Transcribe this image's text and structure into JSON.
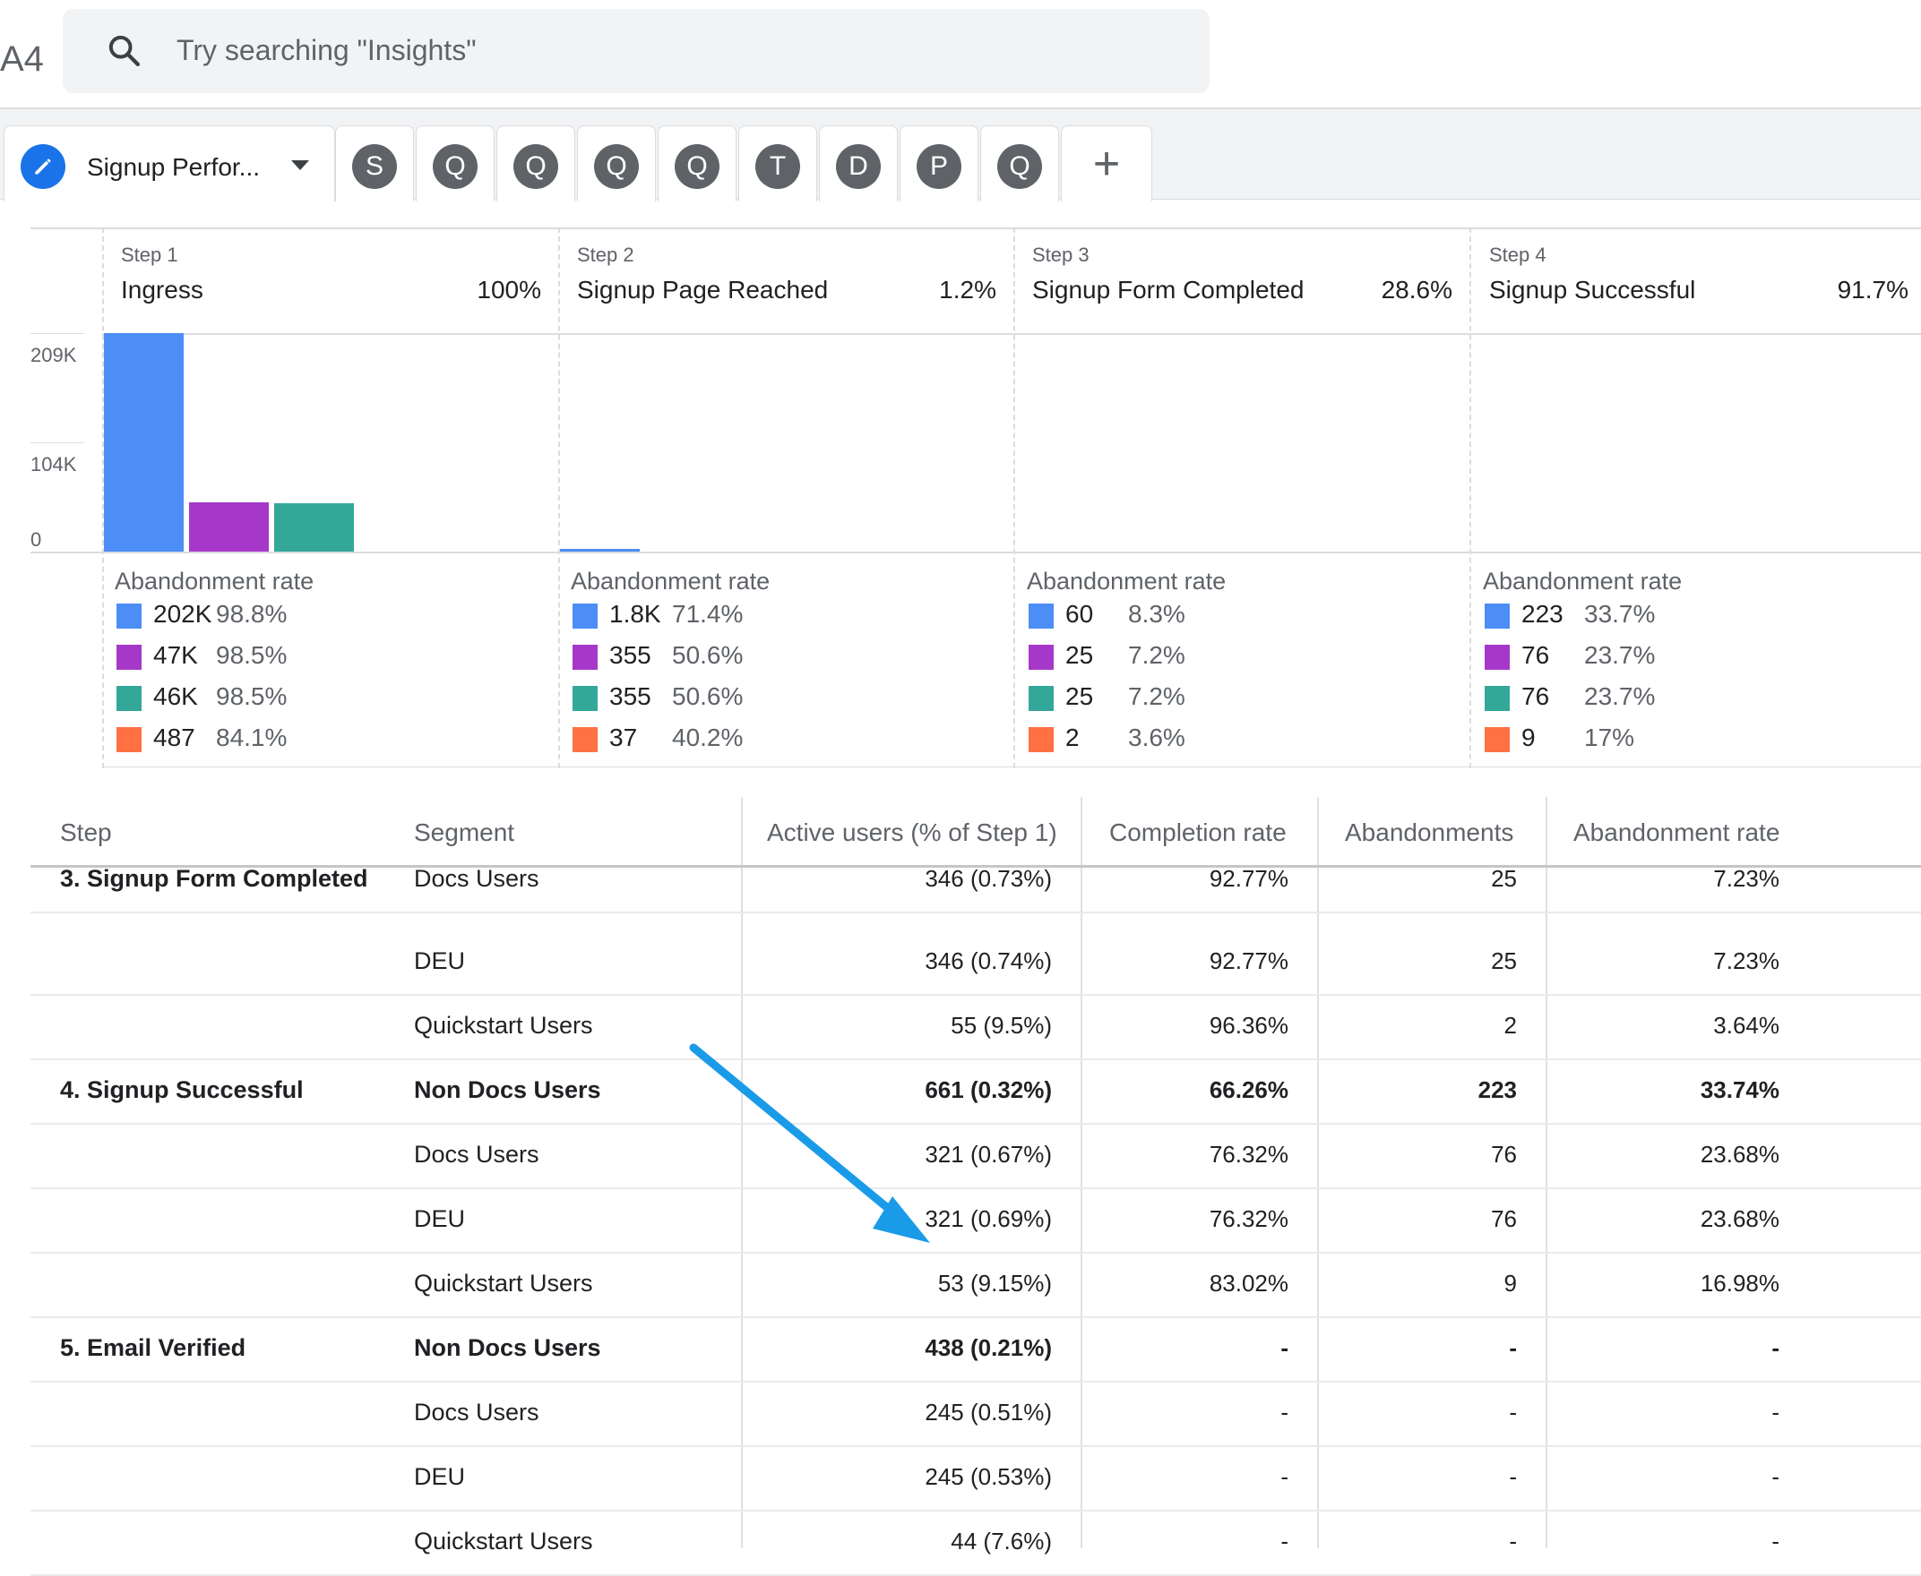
{
  "brand": "A4",
  "search": {
    "placeholder": "Try searching \"Insights\"",
    "icon": "search-icon"
  },
  "tabs": {
    "active": {
      "label": "Signup Perfor...",
      "icon": "pencil-icon"
    },
    "others": [
      "S",
      "Q",
      "Q",
      "Q",
      "Q",
      "T",
      "D",
      "P",
      "Q"
    ],
    "add_label": "+"
  },
  "colors": {
    "blue": "#4c8df6",
    "purple": "#a638c9",
    "teal": "#33a89a",
    "orange": "#ff7043",
    "arrow": "#1a9be8"
  },
  "funnel": {
    "steps": [
      {
        "step": "Step 1",
        "name": "Ingress",
        "pct": "100%"
      },
      {
        "step": "Step 2",
        "name": "Signup Page Reached",
        "pct": "1.2%"
      },
      {
        "step": "Step 3",
        "name": "Signup Form Completed",
        "pct": "28.6%"
      },
      {
        "step": "Step 4",
        "name": "Signup Successful",
        "pct": "91.7%"
      }
    ],
    "axis": [
      "209K",
      "104K",
      "0"
    ],
    "abandonment_title": "Abandonment rate",
    "abandonment": [
      [
        {
          "v": "202K",
          "p": "98.8%"
        },
        {
          "v": "47K",
          "p": "98.5%"
        },
        {
          "v": "46K",
          "p": "98.5%"
        },
        {
          "v": "487",
          "p": "84.1%"
        }
      ],
      [
        {
          "v": "1.8K",
          "p": "71.4%"
        },
        {
          "v": "355",
          "p": "50.6%"
        },
        {
          "v": "355",
          "p": "50.6%"
        },
        {
          "v": "37",
          "p": "40.2%"
        }
      ],
      [
        {
          "v": "60",
          "p": "8.3%"
        },
        {
          "v": "25",
          "p": "7.2%"
        },
        {
          "v": "25",
          "p": "7.2%"
        },
        {
          "v": "2",
          "p": "3.6%"
        }
      ],
      [
        {
          "v": "223",
          "p": "33.7%"
        },
        {
          "v": "76",
          "p": "23.7%"
        },
        {
          "v": "76",
          "p": "23.7%"
        },
        {
          "v": "9",
          "p": "17%"
        }
      ]
    ]
  },
  "chart_data": {
    "type": "bar",
    "categories": [
      "Ingress",
      "Signup Page Reached",
      "Signup Form Completed",
      "Signup Successful"
    ],
    "series": [
      {
        "name": "",
        "values": [
          209000,
          2500,
          0,
          0
        ]
      },
      {
        "name": "",
        "values": [
          47000,
          0,
          0,
          0
        ]
      },
      {
        "name": "",
        "values": [
          46000,
          0,
          0,
          0
        ]
      }
    ],
    "ylabel": "",
    "yticks": [
      "0",
      "104K",
      "209K"
    ],
    "ylim": [
      0,
      209000
    ]
  },
  "table": {
    "headers": [
      "Step",
      "Segment",
      "Active users (% of Step 1)",
      "Completion rate",
      "Abandonments",
      "Abandonment rate"
    ],
    "rows": [
      {
        "step": "3. Signup Form Completed",
        "segment": "Docs Users",
        "active": "346 (0.73%)",
        "completion": "92.77%",
        "aband": "25",
        "rate": "7.23%",
        "bold": false
      },
      {
        "step": "",
        "segment": "DEU",
        "active": "346 (0.74%)",
        "completion": "92.77%",
        "aband": "25",
        "rate": "7.23%",
        "bold": false
      },
      {
        "step": "",
        "segment": "Quickstart Users",
        "active": "55 (9.5%)",
        "completion": "96.36%",
        "aband": "2",
        "rate": "3.64%",
        "bold": false
      },
      {
        "step": "4. Signup Successful",
        "segment": "Non Docs Users",
        "active": "661 (0.32%)",
        "completion": "66.26%",
        "aband": "223",
        "rate": "33.74%",
        "bold": true
      },
      {
        "step": "",
        "segment": "Docs Users",
        "active": "321 (0.67%)",
        "completion": "76.32%",
        "aband": "76",
        "rate": "23.68%",
        "bold": false
      },
      {
        "step": "",
        "segment": "DEU",
        "active": "321 (0.69%)",
        "completion": "76.32%",
        "aband": "76",
        "rate": "23.68%",
        "bold": false
      },
      {
        "step": "",
        "segment": "Quickstart Users",
        "active": "53 (9.15%)",
        "completion": "83.02%",
        "aband": "9",
        "rate": "16.98%",
        "bold": false
      },
      {
        "step": "5. Email Verified",
        "segment": "Non Docs Users",
        "active": "438 (0.21%)",
        "completion": "-",
        "aband": "-",
        "rate": "-",
        "bold": true
      },
      {
        "step": "",
        "segment": "Docs Users",
        "active": "245 (0.51%)",
        "completion": "-",
        "aband": "-",
        "rate": "-",
        "bold": false
      },
      {
        "step": "",
        "segment": "DEU",
        "active": "245 (0.53%)",
        "completion": "-",
        "aband": "-",
        "rate": "-",
        "bold": false
      },
      {
        "step": "",
        "segment": "Quickstart Users",
        "active": "44 (7.6%)",
        "completion": "-",
        "aband": "-",
        "rate": "-",
        "bold": false
      }
    ]
  }
}
